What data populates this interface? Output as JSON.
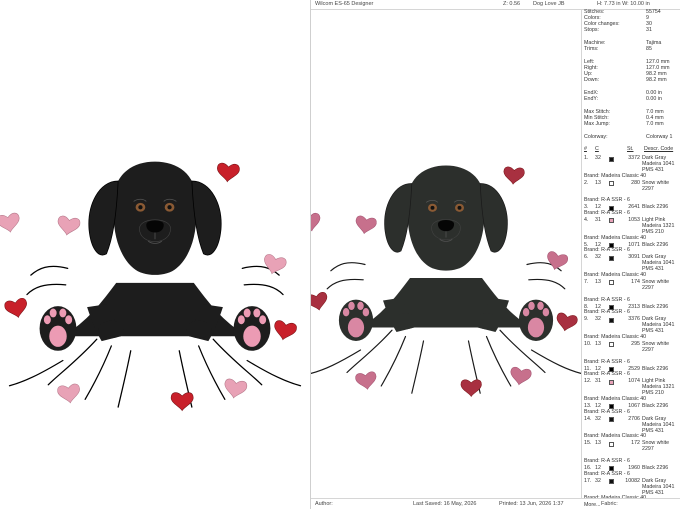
{
  "header": {
    "app_title": "Wilcom ES-65 Designer",
    "zoom": "Z: 0.56",
    "design_name": "Dog Love JB",
    "dimensions": "H: 7.73 in    W: 10.00 in"
  },
  "info": {
    "stitches_label": "Stitches:",
    "stitches": "55754",
    "colors_label": "Colors:",
    "colors": "9",
    "color_changes_label": "Color changes:",
    "color_changes": "30",
    "stops_label": "Stops:",
    "stops": "31",
    "machine_label": "Machine:",
    "machine": "Tajima",
    "trims_label": "Trims:",
    "trims": "85",
    "left_label": "Left:",
    "left": "127.0 mm",
    "right_label": "Right:",
    "right": "127.0 mm",
    "up_label": "Up:",
    "up": "98.2 mm",
    "down_label": "Down:",
    "down": "98.2 mm",
    "endx_label": "EndX:",
    "endx": "0.00 in",
    "endy_label": "EndY:",
    "endy": "0.00 in",
    "max_stitch_label": "Max Stitch:",
    "max_stitch": "7.0 mm",
    "min_stitch_label": "Min Stitch:",
    "min_stitch": "0.4 mm",
    "max_jump_label": "Max Jump:",
    "max_jump": "7.0 mm",
    "colorway_label": "Colorway:",
    "colorway": "Colorway 1"
  },
  "thread_columns": {
    "num": "#",
    "color": "C",
    "stitches": "St.",
    "desc": "Descr. Code"
  },
  "threads": [
    {
      "num": "1.",
      "code": "32",
      "swatch": "#111111",
      "stitches": "3372",
      "desc": "Dark Gray Madeira 1041 PMS 431",
      "brand": "Brand: Madeira Classic 40"
    },
    {
      "num": "2.",
      "code": "13",
      "swatch": "#ffffff",
      "stitches": "280",
      "desc": "Snow white 2297",
      "brand": "Brand: R-A SSR - 6"
    },
    {
      "num": "3.",
      "code": "12",
      "swatch": "#000000",
      "stitches": "2641",
      "desc": "Black 2296",
      "brand": "Brand: R-A SSR - 6"
    },
    {
      "num": "4.",
      "code": "31",
      "swatch": "#e7a2b8",
      "stitches": "1053",
      "desc": "Light Pink Madeira 1321 PMS 210",
      "brand": "Brand: Madeira Classic 40"
    },
    {
      "num": "5.",
      "code": "12",
      "swatch": "#000000",
      "stitches": "1071",
      "desc": "Black 2296",
      "brand": "Brand: R-A SSR - 6"
    },
    {
      "num": "6.",
      "code": "32",
      "swatch": "#111111",
      "stitches": "3091",
      "desc": "Dark Gray Madeira 1041 PMS 431",
      "brand": "Brand: Madeira Classic 40"
    },
    {
      "num": "7.",
      "code": "13",
      "swatch": "#ffffff",
      "stitches": "174",
      "desc": "Snow white 2297",
      "brand": "Brand: R-A SSR - 6"
    },
    {
      "num": "8.",
      "code": "12",
      "swatch": "#000000",
      "stitches": "2313",
      "desc": "Black 2296",
      "brand": "Brand: R-A SSR - 6"
    },
    {
      "num": "9.",
      "code": "32",
      "swatch": "#111111",
      "stitches": "3376",
      "desc": "Dark Gray Madeira 1041 PMS 431",
      "brand": "Brand: Madeira Classic 40"
    },
    {
      "num": "10.",
      "code": "13",
      "swatch": "#ffffff",
      "stitches": "295",
      "desc": "Snow white 2297",
      "brand": "Brand: R-A SSR - 6"
    },
    {
      "num": "11.",
      "code": "12",
      "swatch": "#000000",
      "stitches": "2529",
      "desc": "Black 2296",
      "brand": "Brand: R-A SSR - 6"
    },
    {
      "num": "12.",
      "code": "31",
      "swatch": "#e7a2b8",
      "stitches": "1074",
      "desc": "Light Pink Madeira 1321 PMS 210",
      "brand": "Brand: Madeira Classic 40"
    },
    {
      "num": "13.",
      "code": "12",
      "swatch": "#000000",
      "stitches": "1067",
      "desc": "Black 2296",
      "brand": "Brand: R-A SSR - 6"
    },
    {
      "num": "14.",
      "code": "32",
      "swatch": "#111111",
      "stitches": "2706",
      "desc": "Dark Gray Madeira 1041 PMS 431",
      "brand": "Brand: Madeira Classic 40"
    },
    {
      "num": "15.",
      "code": "13",
      "swatch": "#ffffff",
      "stitches": "172",
      "desc": "Snow white 2297",
      "brand": "Brand: R-A SSR - 6"
    },
    {
      "num": "16.",
      "code": "12",
      "swatch": "#000000",
      "stitches": "1960",
      "desc": "Black 2296",
      "brand": "Brand: R-A SSR - 6"
    },
    {
      "num": "17.",
      "code": "32",
      "swatch": "#111111",
      "stitches": "10082",
      "desc": "Dark Gray Madeira 1041 PMS 431",
      "brand": "Brand: Madeira Classic 40"
    }
  ],
  "more_label": "More...",
  "footer": {
    "author": "Author:",
    "last_saved": "Last Saved: 16 May, 2026",
    "printed": "Printed: 13 Jun, 2026  1:37",
    "fabric": "Fabric:"
  },
  "colors": {
    "dog_left": "#1d1d1d",
    "dog_right": "#2c2f2c",
    "heart_red": "#c8202a",
    "heart_pink": "#e8a2b6",
    "paw_pink": "#ec9bb4"
  }
}
